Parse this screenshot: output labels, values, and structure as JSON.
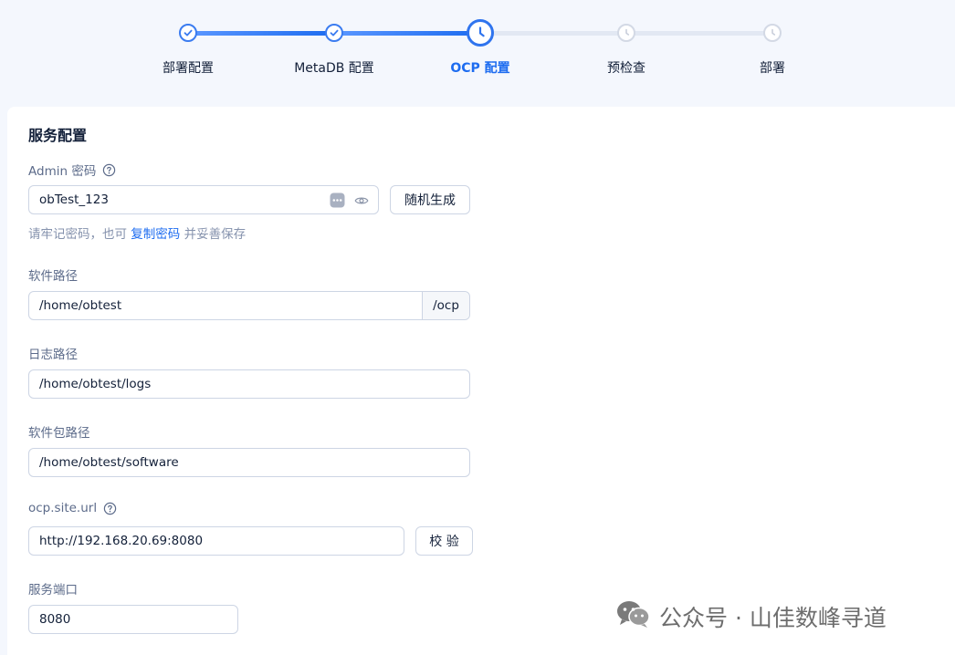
{
  "stepper": {
    "steps": [
      {
        "label": "部署配置",
        "state": "done"
      },
      {
        "label": "MetaDB 配置",
        "state": "done"
      },
      {
        "label": "OCP 配置",
        "state": "current"
      },
      {
        "label": "预检查",
        "state": "todo"
      },
      {
        "label": "部署",
        "state": "todo"
      }
    ]
  },
  "form": {
    "section_title": "服务配置",
    "admin_password": {
      "label": "Admin 密码",
      "value": "obTest_123",
      "generate_label": "随机生成",
      "hint_prefix": "请牢记密码，也可",
      "hint_link": "复制密码",
      "hint_suffix": "并妥善保存"
    },
    "software_path": {
      "label": "软件路径",
      "value": "/home/obtest",
      "suffix": "/ocp"
    },
    "log_path": {
      "label": "日志路径",
      "value": "/home/obtest/logs"
    },
    "package_path": {
      "label": "软件包路径",
      "value": "/home/obtest/software"
    },
    "site_url": {
      "label": "ocp.site.url",
      "value": "http://192.168.20.69:8080",
      "verify_label": "校 验"
    },
    "service_port": {
      "label": "服务端口",
      "value": "8080"
    }
  },
  "watermark": {
    "text": "公众号 · 山佳数峰寻道",
    "icon": "wechat-icon"
  },
  "colors": {
    "primary": "#1d6cf0",
    "text": "#132039",
    "label": "#5c6b8a",
    "border": "#cdd5e4",
    "background": "#f4f7fd"
  }
}
